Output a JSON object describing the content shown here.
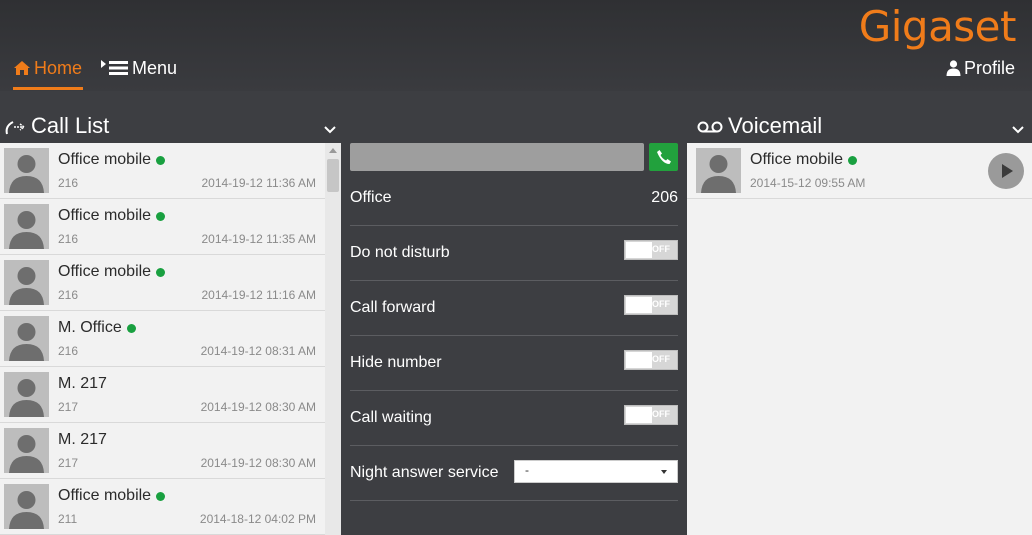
{
  "brand": {
    "logo_text": "Gigaset",
    "accent": "#f07c1a"
  },
  "nav": {
    "home_label": "Home",
    "menu_label": "Menu",
    "profile_label": "Profile"
  },
  "call_list": {
    "title": "Call List",
    "items": [
      {
        "name": "Office mobile",
        "online": true,
        "number": "216",
        "time": "2014-19-12 11:36 AM"
      },
      {
        "name": "Office mobile",
        "online": true,
        "number": "216",
        "time": "2014-19-12 11:35 AM"
      },
      {
        "name": "Office mobile",
        "online": true,
        "number": "216",
        "time": "2014-19-12 11:16 AM"
      },
      {
        "name": "M. Office",
        "online": true,
        "number": "216",
        "time": "2014-19-12 08:31 AM"
      },
      {
        "name": "M. 217",
        "online": false,
        "number": "217",
        "time": "2014-19-12 08:30 AM"
      },
      {
        "name": "M. 217",
        "online": false,
        "number": "217",
        "time": "2014-19-12 08:30 AM"
      },
      {
        "name": "Office mobile",
        "online": true,
        "number": "211",
        "time": "2014-18-12 04:02 PM"
      }
    ]
  },
  "settings": {
    "dial_placeholder": "",
    "office_label": "Office",
    "office_value": "206",
    "toggles": [
      {
        "label": "Do not disturb",
        "state": "OFF"
      },
      {
        "label": "Call forward",
        "state": "OFF"
      },
      {
        "label": "Hide number",
        "state": "OFF"
      },
      {
        "label": "Call waiting",
        "state": "OFF"
      }
    ],
    "night_label": "Night answer service",
    "night_value": "-"
  },
  "voicemail": {
    "title": "Voicemail",
    "items": [
      {
        "name": "Office mobile",
        "online": true,
        "time": "2014-15-12 09:55 AM"
      }
    ]
  }
}
